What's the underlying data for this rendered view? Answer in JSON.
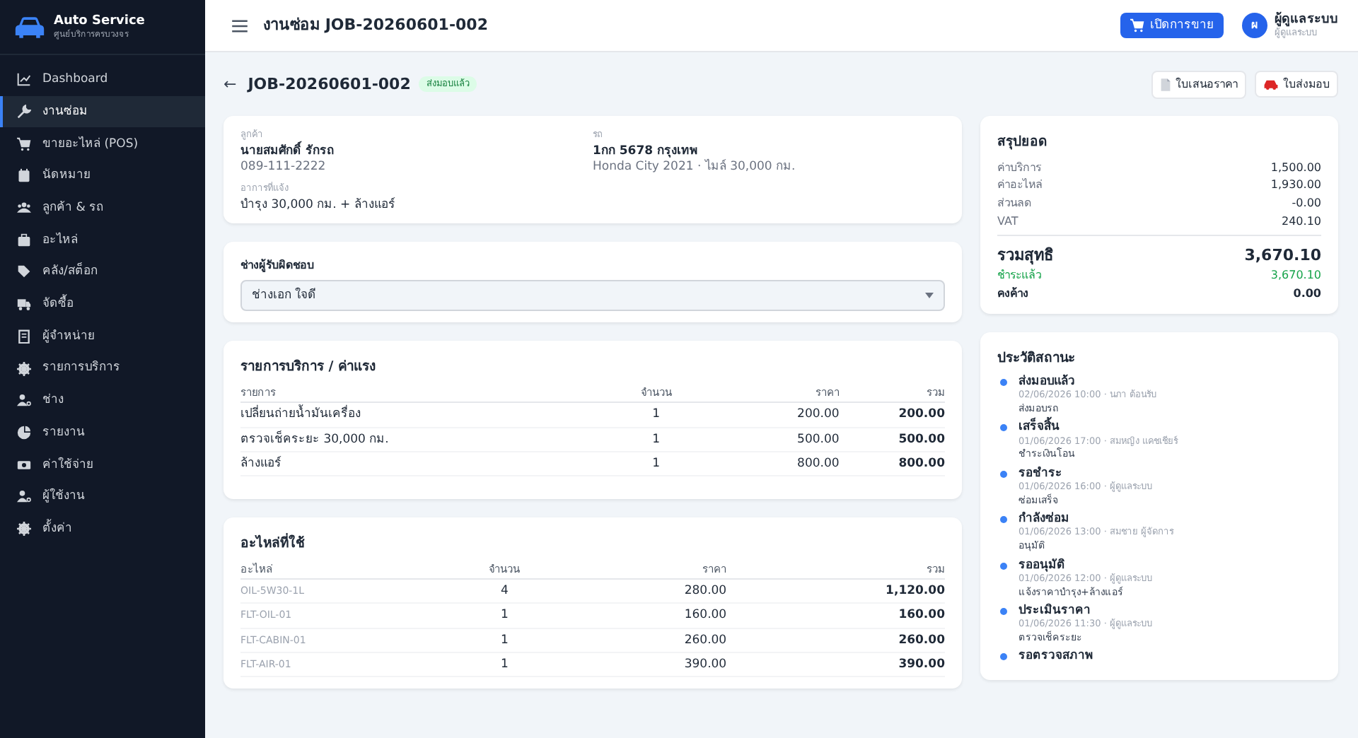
{
  "brand": {
    "title": "Auto Service",
    "subtitle": "ศูนย์บริการครบวงจร"
  },
  "sidebar": {
    "items": [
      {
        "label": "Dashboard",
        "selected": false
      },
      {
        "label": "งานซ่อม",
        "selected": true
      },
      {
        "label": "ขายอะไหล่ (POS)",
        "selected": false
      },
      {
        "label": "นัดหมาย",
        "selected": false
      },
      {
        "label": "ลูกค้า & รถ",
        "selected": false
      },
      {
        "label": "อะไหล่",
        "selected": false
      },
      {
        "label": "คลัง/สต็อก",
        "selected": false
      },
      {
        "label": "จัดซื้อ",
        "selected": false
      },
      {
        "label": "ผู้จำหน่าย",
        "selected": false
      },
      {
        "label": "รายการบริการ",
        "selected": false
      },
      {
        "label": "ช่าง",
        "selected": false
      },
      {
        "label": "รายงาน",
        "selected": false
      },
      {
        "label": "ค่าใช้จ่าย",
        "selected": false
      },
      {
        "label": "ผู้ใช้งาน",
        "selected": false
      },
      {
        "label": "ตั้งค่า",
        "selected": false
      }
    ]
  },
  "topbar": {
    "title": "งานซ่อม JOB-20260601-002",
    "sale_button": "เปิดการขาย",
    "user": {
      "initial": "ผ",
      "name": "ผู้ดูแลระบบ",
      "role": "ผู้ดูแลระบบ"
    }
  },
  "page_header": {
    "back": "←",
    "title": "JOB-20260601-002",
    "status": "ส่งมอบแล้ว",
    "buttons": [
      "ใบเสนอราคา",
      "ใบส่งมอบ"
    ]
  },
  "customer_card": {
    "customer_label": "ลูกค้า",
    "customer_name": "นายสมศักดิ์ รักรถ",
    "phone": "089-111-2222",
    "vehicle_label": "รถ",
    "plate": "1กก 5678 กรุงเทพ",
    "vehicle": "Honda City 2021 · ไมล์ 30,000 กม.",
    "symptom_label": "อาการที่แจ้ง",
    "symptom": "บำรุง 30,000 กม. + ล้างแอร์"
  },
  "technician": {
    "label": "ช่างผู้รับผิดชอบ",
    "value": "ช่างเอก ใจดี"
  },
  "services": {
    "title": "รายการบริการ / ค่าแรง",
    "columns": [
      "รายการ",
      "จำนวน",
      "ราคา",
      "รวม"
    ],
    "rows": [
      [
        "เปลี่ยนถ่ายน้ำมันเครื่อง",
        "1",
        "200.00",
        "200.00"
      ],
      [
        "ตรวจเช็คระยะ 30,000 กม.",
        "1",
        "500.00",
        "500.00"
      ],
      [
        "ล้างแอร์",
        "1",
        "800.00",
        "800.00"
      ]
    ]
  },
  "parts": {
    "title": "อะไหล่ที่ใช้",
    "columns": [
      "อะไหล่",
      "จำนวน",
      "ราคา",
      "รวม"
    ],
    "rows": [
      [
        "OIL-5W30-1L",
        "4",
        "280.00",
        "1,120.00"
      ],
      [
        "FLT-OIL-01",
        "1",
        "160.00",
        "160.00"
      ],
      [
        "FLT-CABIN-01",
        "1",
        "260.00",
        "260.00"
      ],
      [
        "FLT-AIR-01",
        "1",
        "390.00",
        "390.00"
      ]
    ]
  },
  "summary": {
    "title": "สรุปยอด",
    "rows": [
      {
        "kind": "line",
        "label": "ค่าบริการ",
        "value": "1,500.00"
      },
      {
        "kind": "line",
        "label": "ค่าอะไหล่",
        "value": "1,930.00"
      },
      {
        "kind": "line",
        "label": "ส่วนลด",
        "value": "-0.00"
      },
      {
        "kind": "line",
        "label": "VAT",
        "value": "240.10"
      },
      {
        "kind": "total",
        "label": "รวมสุทธิ",
        "value": "3,670.10"
      },
      {
        "kind": "paid",
        "label": "ชำระแล้ว",
        "value": "3,670.10"
      },
      {
        "kind": "due",
        "label": "คงค้าง",
        "value": "0.00"
      }
    ]
  },
  "history": {
    "title": "ประวัติสถานะ",
    "items": [
      {
        "status": "ส่งมอบแล้ว",
        "meta": "02/06/2026 10:00 · นภา ต้อนรับ",
        "note": "ส่งมอบรถ"
      },
      {
        "status": "เสร็จสิ้น",
        "meta": "01/06/2026 17:00 · สมหญิง แคชเชียร์",
        "note": "ชำระเงินโอน"
      },
      {
        "status": "รอชำระ",
        "meta": "01/06/2026 16:00 · ผู้ดูแลระบบ",
        "note": "ซ่อมเสร็จ"
      },
      {
        "status": "กำลังซ่อม",
        "meta": "01/06/2026 13:00 · สมชาย ผู้จัดการ",
        "note": "อนุมัติ"
      },
      {
        "status": "รออนุมัติ",
        "meta": "01/06/2026 12:00 · ผู้ดูแลระบบ",
        "note": "แจ้งราคาบำรุง+ล้างแอร์"
      },
      {
        "status": "ประเมินราคา",
        "meta": "01/06/2026 11:30 · ผู้ดูแลระบบ",
        "note": "ตรวจเช็คระยะ"
      },
      {
        "status": "รอตรวจสภาพ"
      }
    ]
  }
}
